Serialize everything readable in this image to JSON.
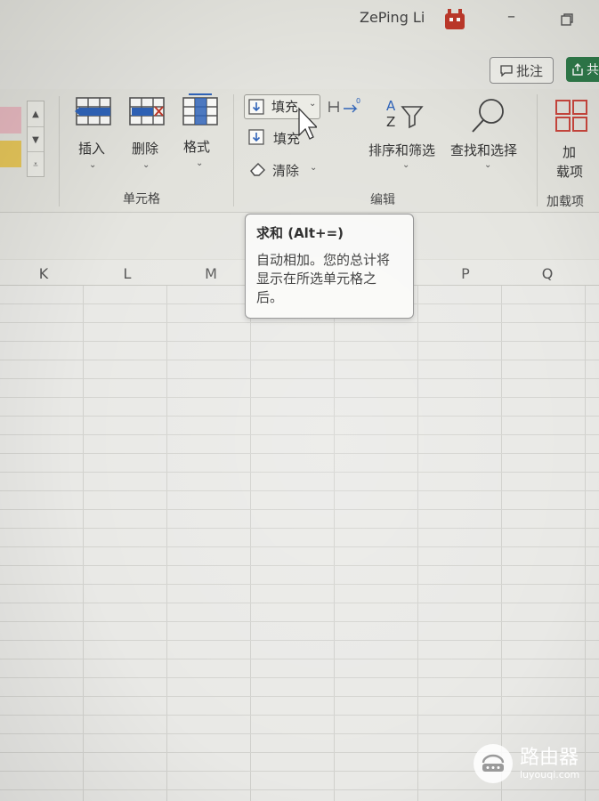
{
  "titlebar": {
    "user_name": "ZePing Li",
    "minimize_glyph": "–",
    "avatar_icon": "avatar-robot-icon",
    "restore_icon": "restore-window-icon"
  },
  "toolbar": {
    "comments_label": "批注",
    "comments_icon": "comment-icon",
    "share_icon": "share-icon",
    "share_label": "共"
  },
  "ribbon": {
    "cells_group": {
      "label": "单元格",
      "insert_label": "插入",
      "delete_label": "删除",
      "format_label": "格式"
    },
    "editing_group": {
      "label": "编辑",
      "autosum_label": "填充",
      "fill_label": "填充",
      "clear_label": "清除",
      "sort_filter_label": "排序和筛选",
      "find_select_label": "查找和选择"
    },
    "addins_group": {
      "label": "加载项",
      "addins_label_line1": "加",
      "addins_label_line2": "载项"
    }
  },
  "columns": [
    "K",
    "L",
    "M",
    "P",
    "Q"
  ],
  "tooltip": {
    "title": "求和 (Alt+=)",
    "body": "自动相加。您的总计将显示在所选单元格之后。"
  },
  "watermark": {
    "title": "路由器",
    "domain": "luyouqi.com"
  },
  "colors": {
    "accent_green": "#2f7a4a",
    "ribbon_blue": "#2f63b8",
    "delete_red": "#c0392b",
    "addins_red": "#c9463d"
  }
}
